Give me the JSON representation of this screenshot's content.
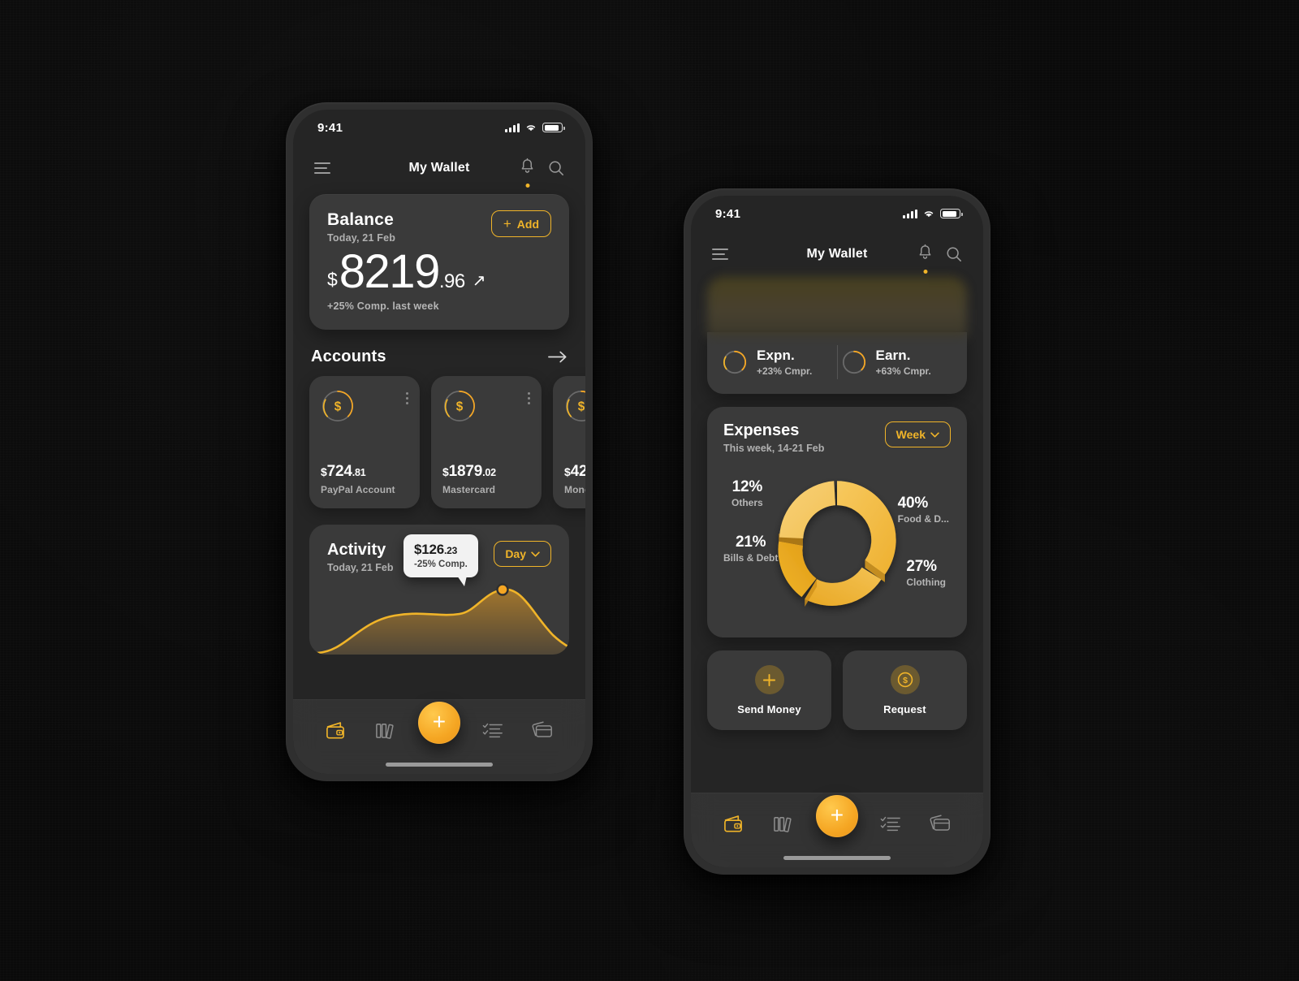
{
  "statusbar": {
    "time": "9:41"
  },
  "header": {
    "title": "My Wallet"
  },
  "phone1": {
    "balance": {
      "title": "Balance",
      "subtitle": "Today, 21 Feb",
      "add_label": "Add",
      "currency": "$",
      "amount_int": "8219",
      "amount_cents": ".96",
      "note": "+25% Comp. last week"
    },
    "accounts": {
      "title": "Accounts",
      "items": [
        {
          "amount_cur": "$",
          "amount_int": "724",
          "amount_cents": ".81",
          "name": "PayPal Account"
        },
        {
          "amount_cur": "$",
          "amount_int": "1879",
          "amount_cents": ".02",
          "name": "Mastercard"
        },
        {
          "amount_cur": "$",
          "amount_int": "42",
          "amount_cents": "",
          "name": "Mone"
        }
      ]
    },
    "activity": {
      "title": "Activity",
      "subtitle": "Today, 21 Feb",
      "range_label": "Day",
      "tooltip_amount_main": "$126",
      "tooltip_amount_cents": ".23",
      "tooltip_note": "-25% Comp."
    }
  },
  "phone2": {
    "stats": [
      {
        "label": "Expn.",
        "value": "+23% Cmpr."
      },
      {
        "label": "Earn.",
        "value": "+63% Cmpr."
      }
    ],
    "expenses": {
      "title": "Expenses",
      "subtitle": "This week, 14-21 Feb",
      "range_label": "Week"
    },
    "actions": [
      {
        "label": "Send Money",
        "icon": "plus-icon"
      },
      {
        "label": "Request",
        "icon": "dollar-circle-icon"
      }
    ]
  },
  "chart_data": {
    "type": "pie",
    "title": "Expenses",
    "subtitle": "This week, 14-21 Feb",
    "categories": [
      "Food & D...",
      "Clothing",
      "Bills & Debt",
      "Others"
    ],
    "values": [
      40,
      27,
      21,
      12
    ],
    "value_labels": [
      "40%",
      "27%",
      "21%",
      "12%"
    ],
    "colors": [
      "#f3bb3f",
      "#f0c150",
      "#e9a520",
      "#f2c75f"
    ],
    "legend": "around-chart",
    "donut": true
  },
  "tabbar": {
    "items": [
      {
        "name": "wallet-icon",
        "active": true
      },
      {
        "name": "books-icon",
        "active": false
      },
      {
        "name": "plus-fab-icon",
        "active": false
      },
      {
        "name": "checklist-icon",
        "active": false
      },
      {
        "name": "cards-icon",
        "active": false
      }
    ]
  },
  "colors": {
    "accent": "#f0b429",
    "fab": "#f5a623",
    "card": "#3a3a3a",
    "bg": "#0a0a0a"
  }
}
